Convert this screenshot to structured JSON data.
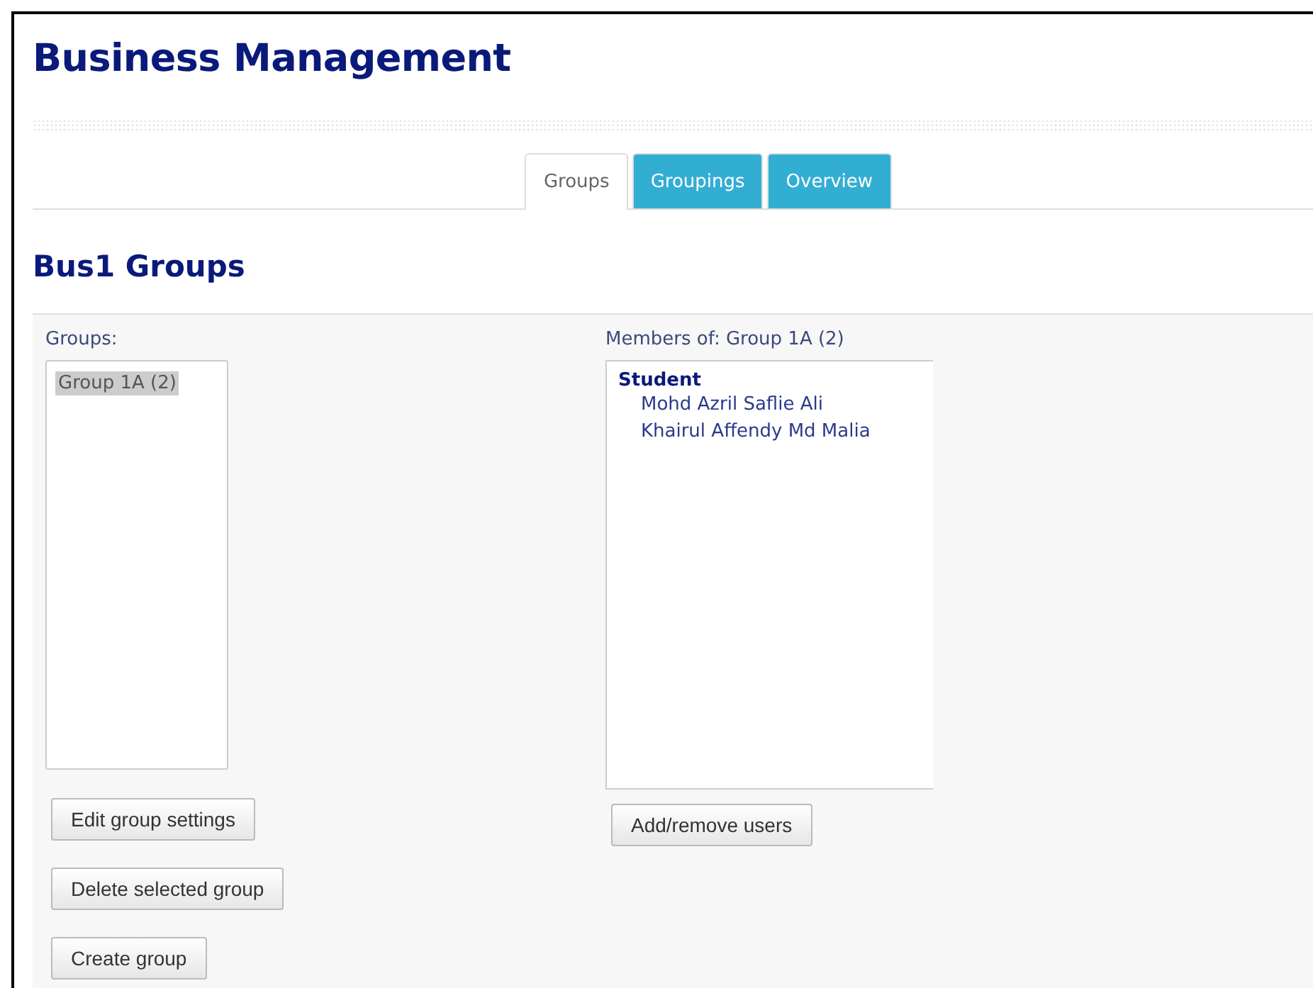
{
  "page_title": "Business Management",
  "tabs": [
    {
      "label": "Groups",
      "selected": true
    },
    {
      "label": "Groupings",
      "selected": false
    },
    {
      "label": "Overview",
      "selected": false
    }
  ],
  "heading": "Bus1 Groups",
  "groups": {
    "label": "Groups:",
    "items": [
      {
        "label": "Group 1A (2)",
        "selected": true
      }
    ],
    "buttons": [
      "Edit group settings",
      "Delete selected group",
      "Create group"
    ]
  },
  "members": {
    "label": "Members of: Group 1A (2)",
    "role": "Student",
    "names": [
      "Mohd Azril Saflie Ali",
      "Khairul Affendy Md Malia"
    ],
    "button": "Add/remove users"
  }
}
